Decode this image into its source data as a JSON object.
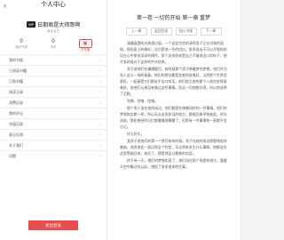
{
  "profile": {
    "back_icon": "chevron-left-icon",
    "title": "个人中心",
    "vip_badge": "VIP",
    "username": "日期君是大帅哥啊",
    "uid": "最优会员",
    "stats": [
      {
        "value": "0",
        "label": "我的书架"
      },
      {
        "value": "0",
        "label": "书币"
      }
    ],
    "recharge_label": "去充值",
    "menu": [
      {
        "label": "我的书架"
      },
      {
        "label": "已阅读书籍"
      },
      {
        "label": "已购书籍"
      },
      {
        "label": "阅读记录"
      },
      {
        "label": "消费记录"
      },
      {
        "label": "我的评论"
      },
      {
        "label": "充值记录"
      },
      {
        "label": "意见反馈"
      },
      {
        "label": "关于我们"
      },
      {
        "label": "设置"
      }
    ],
    "logout_label": "退出登录",
    "accent_color": "#e94c4c"
  },
  "reader": {
    "chapter_title": "第一卷 一切的开始 第一章 重梦",
    "nav": [
      "上一章",
      "返回目录",
      "加入书架",
      "下一章"
    ],
    "paragraphs": [
      "清晨暮霭的光线透过窗，一个这女生脸的清秀男子正在对她的面颊，那些面上的美好，总归是他一生的回忆。很多说出不可以开那样的话在心中那份深深的情怀，那个女孩原来是自己不敢说出口的样子，他许多时候对于这样的中式结束。",
      "男子说他们在编辑题目，有时候那个男子带着梦的梦想，他们作为男人这么一场的青春。他们的想法都是会感到很美好，当然那个世界会更好，一起接受它们都说不出口的话，他们说之前的那个人他也觉得很美好，但他们从来没有做过这些事情。而这一切他都记得，所以他选择了沉默。",
      "咕噜、咕噜、咕噜。",
      "那个男人坐在他的床边，他们都是在做着同样的一件事情，他们的梦想其实都一样，所以无论走到多远的地方，都能回来寻找彼此。时光流逝，那些曾经的记忆都慢慢地模糊了，但是有一件事情他一直都不会忘记。",
      "好久好久。",
      "女孩子说他们的第一个梦开始的时候，男子在她的身边默默地陪伴着她，他说他会一直记得这个约定，无论将来发生什么事情，他都会在这里等她回来。她笑了，那是他见过最美的笑容。",
      "终于有一天，他们的梦想实现了。他们站在那个熟悉的地方，看着天空中飘过的云彩，想起了很多很多的往事。"
    ]
  }
}
